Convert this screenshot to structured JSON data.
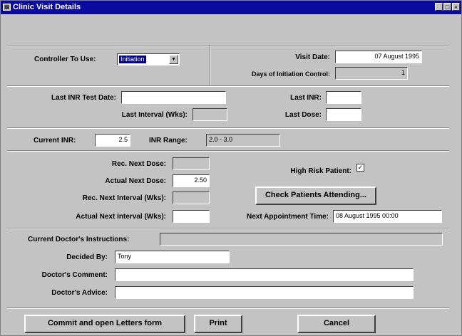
{
  "window": {
    "title": "Clinic Visit Details",
    "icons": [
      "window-menu-icon",
      "minimize-icon",
      "maximize-icon",
      "close-icon"
    ]
  },
  "controller": {
    "label": "Controller To Use:",
    "value": "Initiation"
  },
  "visit": {
    "date_label": "Visit Date:",
    "date_value": "07 August 1995",
    "days_label": "Days of Initiation Control:",
    "days_value": "1"
  },
  "last_test": {
    "date_label": "Last INR Test Date:",
    "date_value": "",
    "interval_label": "Last Interval (Wks):",
    "interval_value": "",
    "inr_label": "Last INR:",
    "inr_value": "",
    "dose_label": "Last Dose:",
    "dose_value": ""
  },
  "current": {
    "inr_label": "Current INR:",
    "inr_value": "2.5",
    "range_label": "INR Range:",
    "range_value": "2.0 - 3.0"
  },
  "dosing": {
    "rec_dose_label": "Rec. Next Dose:",
    "rec_dose_value": "",
    "actual_dose_label": "Actual Next Dose:",
    "actual_dose_value": "2.50",
    "rec_interval_label": "Rec. Next Interval (Wks):",
    "rec_interval_value": "",
    "actual_interval_label": "Actual Next Interval (Wks):",
    "actual_interval_value": "",
    "high_risk_label": "High Risk Patient:",
    "high_risk_checked": true,
    "check_button": "Check Patients Attending...",
    "next_appt_label": "Next Appointment Time:",
    "next_appt_value": "08 August 1995 00:00"
  },
  "doctor": {
    "instructions_label": "Current Doctor's Instructions:",
    "instructions_value": "",
    "decided_label": "Decided By:",
    "decided_value": "Tony",
    "comment_label": "Doctor's Comment:",
    "comment_value": "",
    "advice_label": "Doctor's Advice:",
    "advice_value": ""
  },
  "buttons": {
    "commit": "Commit and open Letters form",
    "print": "Print",
    "cancel": "Cancel"
  }
}
